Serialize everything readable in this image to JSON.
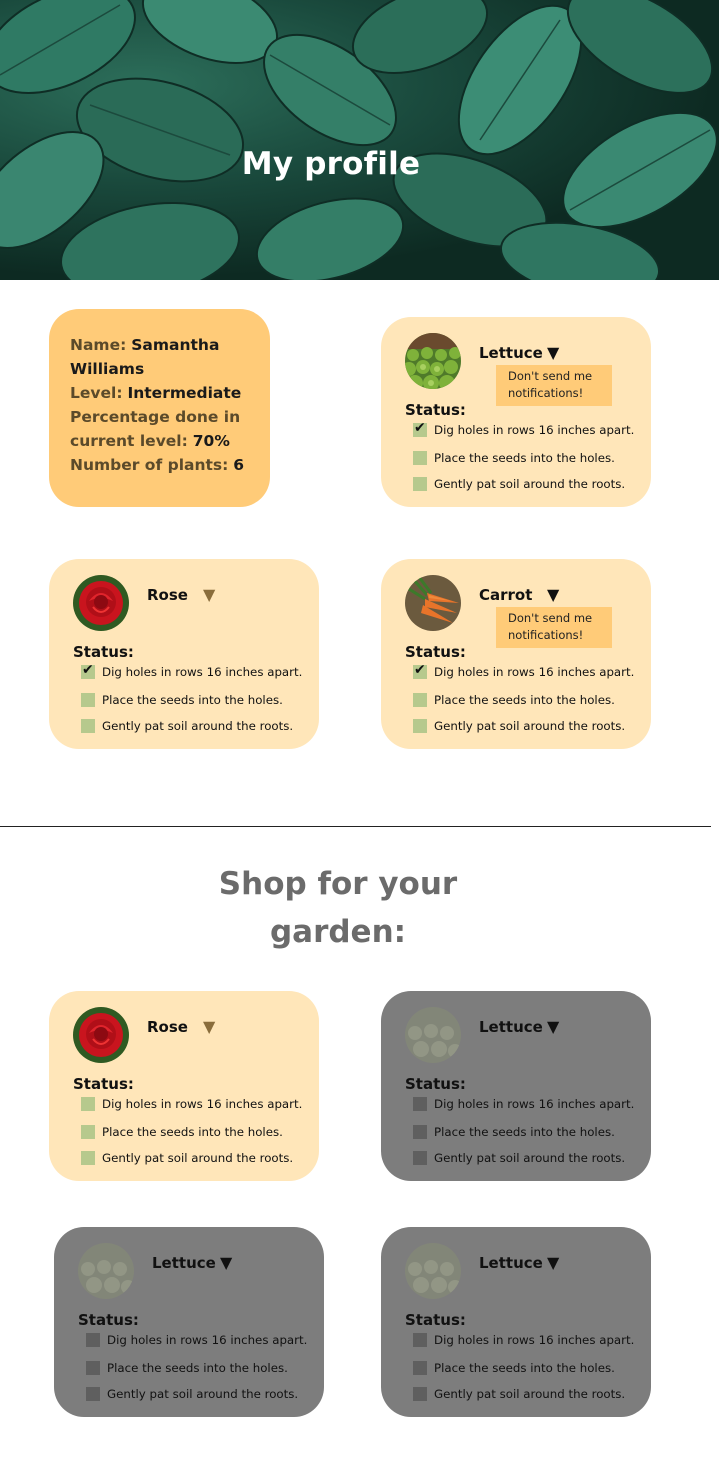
{
  "hero": {
    "title": "My profile"
  },
  "profile": {
    "name_label": "Name:",
    "name_value": "Samantha Williams",
    "level_label": "Level:",
    "level_value": "Intermediate",
    "percent_label": "Percentage done in current level:",
    "percent_value": "70%",
    "plants_label": "Number of plants:",
    "plants_value": "6"
  },
  "my_plants": [
    {
      "name": "Lettuce",
      "arrow": "▼",
      "notify_button": "Don't send me notifications!",
      "status_label": "Status:",
      "tasks": [
        {
          "text": "Dig holes in rows 16 inches apart.",
          "checked": true
        },
        {
          "text": "Place the seeds into the holes.",
          "checked": false
        },
        {
          "text": "Gently pat soil around the roots.",
          "checked": false
        }
      ]
    },
    {
      "name": "Rose",
      "arrow": "▼",
      "status_label": "Status:",
      "tasks": [
        {
          "text": "Dig holes in rows 16 inches apart.",
          "checked": true
        },
        {
          "text": "Place the seeds into the holes.",
          "checked": false
        },
        {
          "text": "Gently pat soil around the roots.",
          "checked": false
        }
      ]
    },
    {
      "name": "Carrot",
      "arrow": "▼",
      "notify_button": "Don't send me notifications!",
      "status_label": "Status:",
      "tasks": [
        {
          "text": "Dig holes in rows 16 inches apart.",
          "checked": true
        },
        {
          "text": "Place the seeds into the holes.",
          "checked": false
        },
        {
          "text": "Gently pat soil around the roots.",
          "checked": false
        }
      ]
    }
  ],
  "shop": {
    "title": "Shop for your garden:",
    "items": [
      {
        "name": "Rose",
        "arrow": "▼",
        "status_label": "Status:",
        "state": "available",
        "tasks": [
          "Dig holes in rows 16 inches apart.",
          "Place the seeds into the holes.",
          "Gently pat soil around the roots."
        ]
      },
      {
        "name": "Lettuce",
        "arrow": "▼",
        "status_label": "Status:",
        "state": "locked",
        "tasks": [
          "Dig holes in rows 16 inches apart.",
          "Place the seeds into the holes.",
          "Gently pat soil around the roots."
        ]
      },
      {
        "name": "Lettuce",
        "arrow": "▼",
        "status_label": "Status:",
        "state": "locked",
        "tasks": [
          "Dig holes in rows 16 inches apart.",
          "Place the seeds into the holes.",
          "Gently pat soil around the roots."
        ]
      },
      {
        "name": "Lettuce",
        "arrow": "▼",
        "status_label": "Status:",
        "state": "locked",
        "tasks": [
          "Dig holes in rows 16 inches apart.",
          "Place the seeds into the holes.",
          "Gently pat soil around the roots."
        ]
      }
    ]
  },
  "colors": {
    "profile_card": "#ffcb78",
    "plant_card": "#ffe6b9",
    "locked_card": "#7d7d7d",
    "checkbox": "#b6c98d",
    "notify_button": "#ffcb78"
  }
}
